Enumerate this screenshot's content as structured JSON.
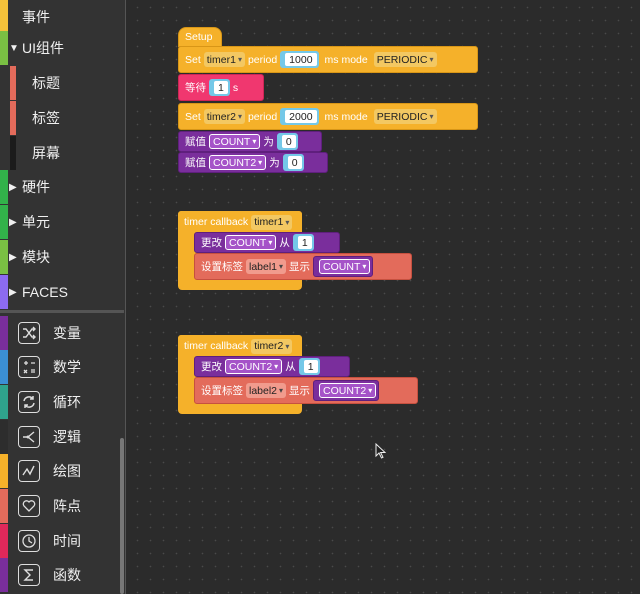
{
  "sidebar": {
    "categories": [
      {
        "label": "事件",
        "color": "#f5c23a"
      },
      {
        "label": "UI组件",
        "color": "#7ac043"
      },
      {
        "label": "标题",
        "color": "#e36b5b"
      },
      {
        "label": "标签",
        "color": "#e36b5b"
      },
      {
        "label": "屏幕",
        "color": "#1b1b1b"
      },
      {
        "label": "硬件",
        "color": "#32b24a"
      },
      {
        "label": "单元",
        "color": "#32b24a"
      },
      {
        "label": "模块",
        "color": "#7ac043"
      },
      {
        "label": "FACES",
        "color": "#8c6bf0"
      }
    ],
    "tools": [
      {
        "label": "变量",
        "color": "#7a2e9c",
        "icon": "shuffle-icon"
      },
      {
        "label": "数学",
        "color": "#3b8fd4",
        "icon": "calculator-icon"
      },
      {
        "label": "循环",
        "color": "#2fa38c",
        "icon": "loop-icon"
      },
      {
        "label": "逻辑",
        "color": "#2d2d2d",
        "icon": "branch-icon"
      },
      {
        "label": "绘图",
        "color": "#f5b12a",
        "icon": "chart-icon"
      },
      {
        "label": "阵点",
        "color": "#e36b5b",
        "icon": "heart-icon"
      },
      {
        "label": "时间",
        "color": "#e0285a",
        "icon": "clock-icon"
      },
      {
        "label": "函数",
        "color": "#7a2e9c",
        "icon": "sigma-icon"
      }
    ]
  },
  "workspace": {
    "setup": {
      "hat": "Setup",
      "set1": {
        "set": "Set",
        "timer": "timer1",
        "period": "period",
        "value": "1000",
        "ms_mode": "ms mode",
        "mode": "PERIODIC"
      },
      "wait": {
        "label": "等待",
        "value": "1",
        "unit": "s"
      },
      "set2": {
        "set": "Set",
        "timer": "timer2",
        "period": "period",
        "value": "2000",
        "ms_mode": "ms mode",
        "mode": "PERIODIC"
      },
      "assign1": {
        "label": "赋值",
        "var": "COUNT",
        "as": "为",
        "value": "0"
      },
      "assign2": {
        "label": "赋值",
        "var": "COUNT2",
        "as": "为",
        "value": "0"
      }
    },
    "callback1": {
      "hat": "timer callback",
      "timer": "timer1",
      "change": {
        "label": "更改",
        "var": "COUNT",
        "from": "从",
        "value": "1"
      },
      "setlabel": {
        "label": "设置标签",
        "target": "label1",
        "show": "显示",
        "var": "COUNT"
      }
    },
    "callback2": {
      "hat": "timer callback",
      "timer": "timer2",
      "change": {
        "label": "更改",
        "var": "COUNT2",
        "from": "从",
        "value": "1"
      },
      "setlabel": {
        "label": "设置标签",
        "target": "label2",
        "show": "显示",
        "var": "COUNT2"
      }
    }
  }
}
